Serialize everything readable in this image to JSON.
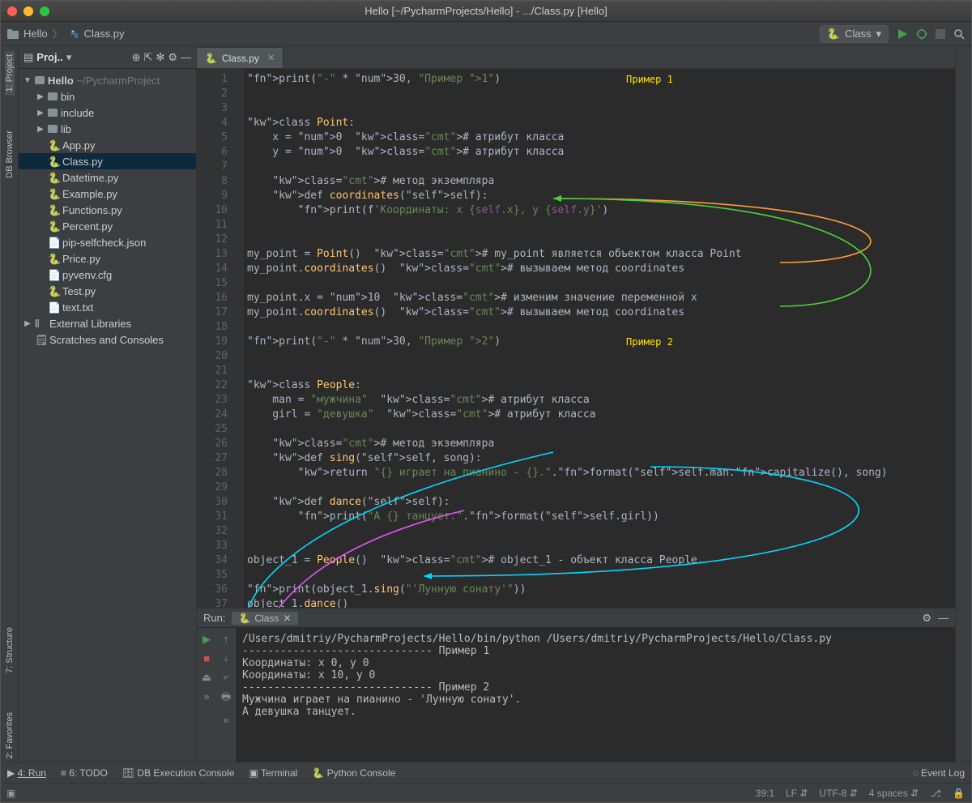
{
  "window": {
    "title": "Hello [~/PycharmProjects/Hello] - .../Class.py [Hello]"
  },
  "breadcrumb": {
    "project": "Hello",
    "file": "Class.py"
  },
  "run_config": {
    "label": "Class"
  },
  "sidebar_tabs": {
    "project": "1: Project",
    "db": "DB Browser",
    "structure": "7: Structure",
    "favorites": "2: Favorites"
  },
  "project_panel": {
    "title": "Proj..",
    "tree": {
      "root": "Hello",
      "root_path": "~/PycharmProject",
      "dirs": [
        "bin",
        "include",
        "lib"
      ],
      "files": [
        "App.py",
        "Class.py",
        "Datetime.py",
        "Example.py",
        "Functions.py",
        "Percent.py",
        "pip-selfcheck.json",
        "Price.py",
        "pyvenv.cfg",
        "Test.py",
        "text.txt"
      ],
      "selected": "Class.py",
      "extlib": "External Libraries",
      "scratches": "Scratches and Consoles"
    }
  },
  "editor_tab": {
    "label": "Class.py"
  },
  "badges": {
    "ex1": "Пример 1",
    "ex2": "Пример 2"
  },
  "code_lines": [
    "print(\"-\" * 30, \"Пример 1\")",
    "",
    "",
    "class Point:",
    "    x = 0  # атрибут класса",
    "    y = 0  # атрибут класса",
    "",
    "    # метод экземпляра",
    "    def coordinates(self):",
    "        print(f'Координаты: x {self.x}, y {self.y}')",
    "",
    "",
    "my_point = Point()  # my_point является объектом класса Point",
    "my_point.coordinates()  # вызываем метод coordinates",
    "",
    "my_point.x = 10  # изменим значение переменной x",
    "my_point.coordinates()  # вызываем метод coordinates",
    "",
    "print(\"-\" * 30, \"Пример 2\")",
    "",
    "",
    "class People:",
    "    man = \"мужчина\"  # атрибут класса",
    "    girl = \"девушка\"  # атрибут класса",
    "",
    "    # метод экземпляра",
    "    def sing(self, song):",
    "        return \"{} играет на пианино - {}.\".format(self.man.capitalize(), song)",
    "",
    "    def dance(self):",
    "        print(\"А {} танцует.\".format(self.girl))",
    "",
    "",
    "object_1 = People()  # object_1 - объект класса People.",
    "",
    "print(object_1.sing(\"'Лунную сонату'\"))",
    "object_1.dance()",
    ""
  ],
  "run": {
    "label": "Run:",
    "tab": "Class",
    "output": "/Users/dmitriy/PycharmProjects/Hello/bin/python /Users/dmitriy/PycharmProjects/Hello/Class.py\n------------------------------ Пример 1\nКоординаты: x 0, y 0\nКоординаты: x 10, y 0\n------------------------------ Пример 2\nМужчина играет на пианино - 'Лунную сонату'.\nА девушка танцует."
  },
  "bottom_tools": {
    "run": "4: Run",
    "todo": "6: TODO",
    "db": "DB Execution Console",
    "terminal": "Terminal",
    "pycon": "Python Console",
    "eventlog": "Event Log"
  },
  "status": {
    "pos": "39:1",
    "line_sep": "LF",
    "encoding": "UTF-8",
    "indent": "4 spaces"
  }
}
